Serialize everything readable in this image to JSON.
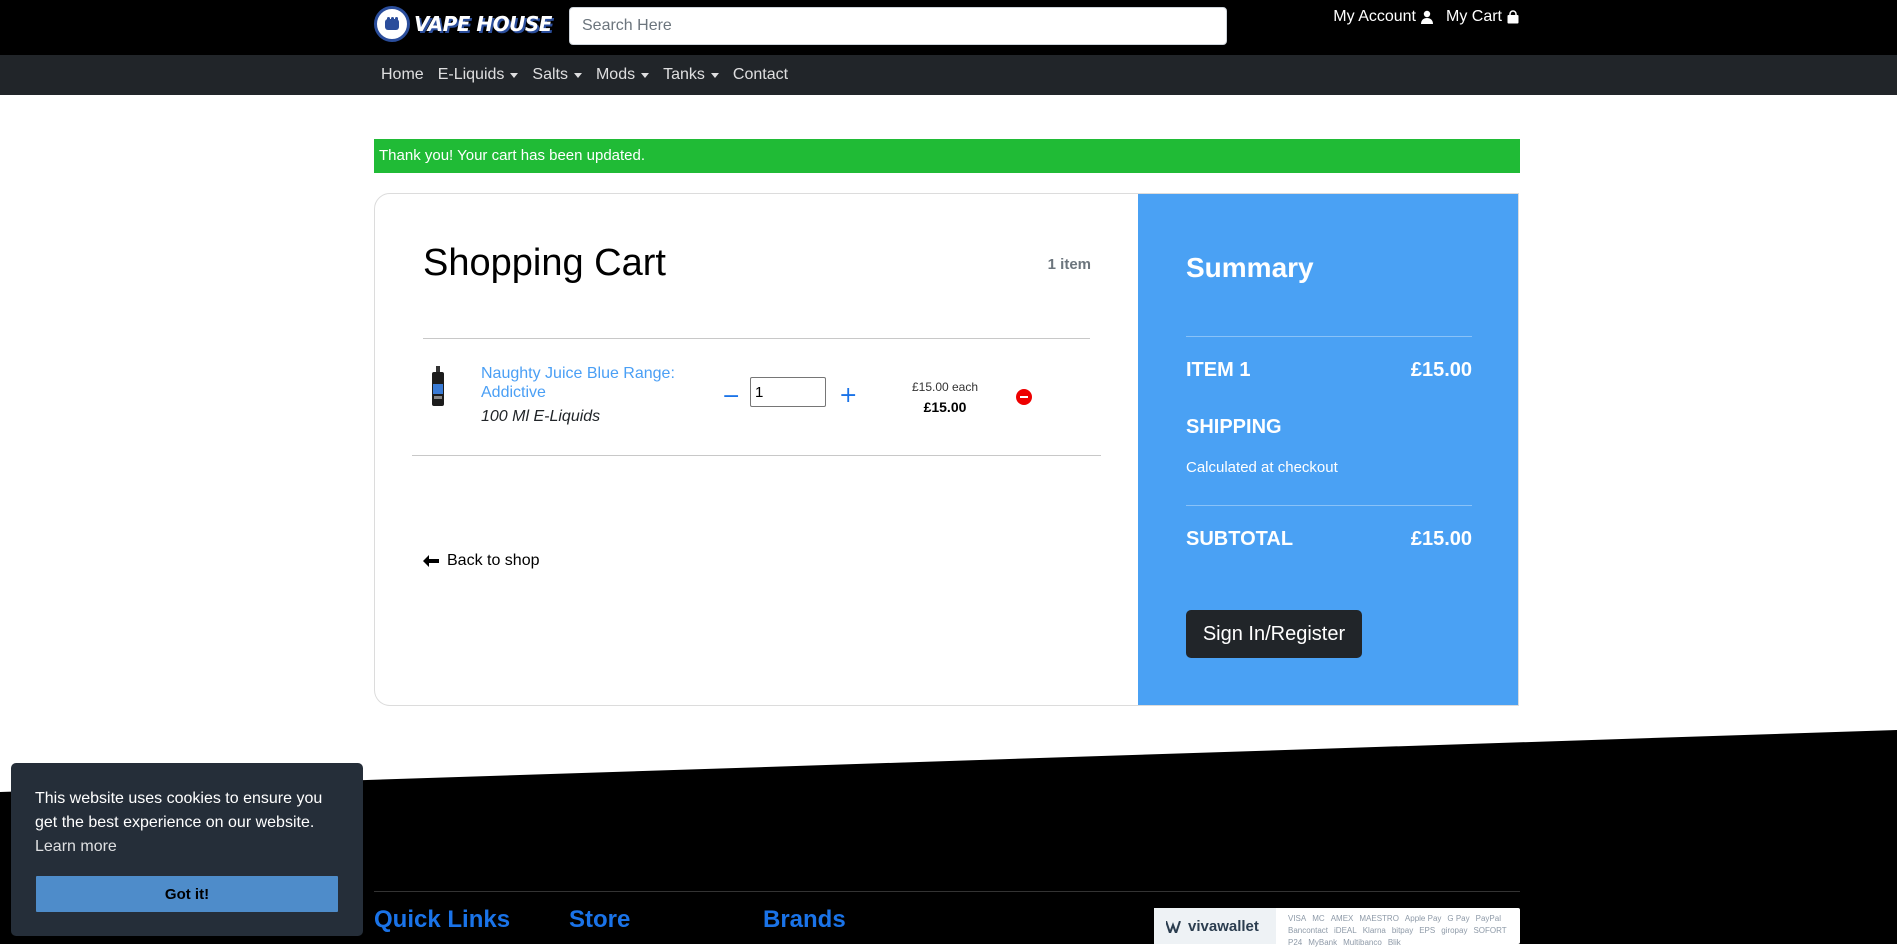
{
  "header": {
    "logo_text": "VAPE HOUSE",
    "search_placeholder": "Search Here",
    "account_label": "My Account",
    "cart_label": "My Cart"
  },
  "nav": {
    "items": [
      {
        "label": "Home",
        "dropdown": false
      },
      {
        "label": "E-Liquids",
        "dropdown": true
      },
      {
        "label": "Salts",
        "dropdown": true
      },
      {
        "label": "Mods",
        "dropdown": true
      },
      {
        "label": "Tanks",
        "dropdown": true
      },
      {
        "label": "Contact",
        "dropdown": false
      }
    ]
  },
  "alert": {
    "message": "Thank you! Your cart has been updated.",
    "color": "#20bb36"
  },
  "cart": {
    "title": "Shopping Cart",
    "item_count": "1 item",
    "items": [
      {
        "name": "Naughty Juice Blue Range: Addictive",
        "category": "100 Ml E-Liquids",
        "quantity": "1",
        "price_each": "£15.00 each",
        "line_total": "£15.00"
      }
    ],
    "back_label": "Back to shop"
  },
  "summary": {
    "title": "Summary",
    "item_label": "ITEM 1",
    "item_value": "£15.00",
    "shipping_label": "SHIPPING",
    "shipping_note": "Calculated at checkout",
    "subtotal_label": "SUBTOTAL",
    "subtotal_value": "£15.00",
    "button_label": "Sign In/Register",
    "color": "#4aa1f4"
  },
  "footer": {
    "headings": [
      "Quick Links",
      "Store",
      "Brands"
    ],
    "payment_brand": "vivawallet",
    "payment_logos": [
      "VISA",
      "MC",
      "AMEX",
      "MAESTRO",
      "Apple Pay",
      "G Pay",
      "PayPal",
      "Bancontact",
      "iDEAL",
      "Klarna",
      "bitpay",
      "EPS",
      "giropay",
      "SOFORT",
      "P24",
      "MyBank",
      "Multibanco",
      "Blik"
    ]
  },
  "cookie": {
    "message": "This website uses cookies to ensure you get the best experience on our website.",
    "learn_more": "Learn more",
    "button_label": "Got it!"
  }
}
